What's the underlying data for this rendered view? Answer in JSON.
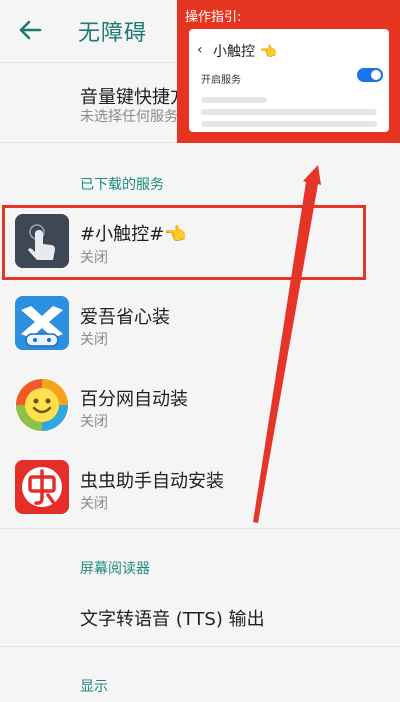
{
  "header": {
    "title": "无障碍",
    "back_icon": "arrow-left-icon"
  },
  "volume_shortcut": {
    "title": "音量键快捷方式",
    "subtitle": "未选择任何服务"
  },
  "downloaded_section": {
    "label": "已下载的服务"
  },
  "services": [
    {
      "name": "#小触控#👈",
      "status": "关闭",
      "icon": "touch-hand-icon"
    },
    {
      "name": "爱吾省心装",
      "status": "关闭",
      "icon": "gamepad-icon"
    },
    {
      "name": "百分网自动装",
      "status": "关闭",
      "icon": "smiley-icon"
    },
    {
      "name": "虫虫助手自动安装",
      "status": "关闭",
      "icon": "chongchong-icon"
    }
  ],
  "screen_reader_section": {
    "label": "屏幕阅读器"
  },
  "tts": {
    "label": "文字转语音 (TTS) 输出"
  },
  "display_section": {
    "label": "显示"
  },
  "guide": {
    "label": "操作指引:",
    "card_title": "小触控 👈",
    "toggle_label": "开启服务",
    "toggle_on": true
  },
  "colors": {
    "accent": "#1f8a7e",
    "highlight": "#e53528",
    "toggle": "#1a73e8"
  }
}
